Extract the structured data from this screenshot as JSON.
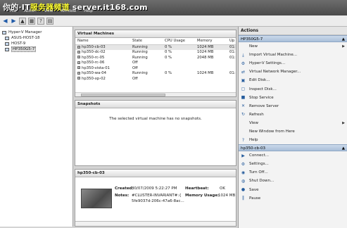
{
  "watermark": {
    "part1": "你的·IT",
    "part2": "服务器频道",
    "part3": " server.it168.com"
  },
  "menu": [
    "File",
    "Action",
    "View",
    "Window",
    "Help"
  ],
  "tree": {
    "root": "Hyper-V Manager",
    "hosts": [
      "ASUS-HOST-18",
      "HOST-9",
      "HP350G5-7"
    ],
    "selected_index": 2
  },
  "vms": {
    "title": "Virtual Machines",
    "columns": [
      "Name",
      "State",
      "CPU Usage",
      "Memory",
      "Up"
    ],
    "rows": [
      {
        "name": "hp350-cb-03",
        "state": "Running",
        "cpu": "0 %",
        "mem": "1024 MB",
        "up": "01:"
      },
      {
        "name": "hp350-dc-02",
        "state": "Running",
        "cpu": "0 %",
        "mem": "1024 MB",
        "up": "01:"
      },
      {
        "name": "hp350-rc-05",
        "state": "Running",
        "cpu": "0 %",
        "mem": "2048 MB",
        "up": "01:"
      },
      {
        "name": "hp350-rc-06",
        "state": "Off",
        "cpu": "",
        "mem": "",
        "up": ""
      },
      {
        "name": "hp350-vista-01",
        "state": "Off",
        "cpu": "",
        "mem": "",
        "up": ""
      },
      {
        "name": "hp350-wa-04",
        "state": "Running",
        "cpu": "0 %",
        "mem": "1024 MB",
        "up": "01:"
      },
      {
        "name": "hp350-xp-02",
        "state": "Off",
        "cpu": "",
        "mem": "",
        "up": ""
      }
    ]
  },
  "snapshots": {
    "title": "Snapshots",
    "message": "The selected virtual machine has no snapshots."
  },
  "details": {
    "title": "hp350-cb-03",
    "created_label": "Created:",
    "created_value": "30/07/2009 5:22:27 PM",
    "heartbeat_label": "Heartbeat:",
    "heartbeat_value": "OK",
    "notes_label": "Notes:",
    "notes_line1": "#CLUSTER-INVARIANT#:{",
    "notes_line2": "5fe9037d-206c-47a6-8ac...",
    "memusage_label": "Memory Usage:",
    "memusage_value": "1024 MB"
  },
  "actions": {
    "title": "Actions",
    "host_section": "HP350G5-7",
    "host_items": [
      {
        "icon": "blank",
        "label": "New",
        "submenu": true
      },
      {
        "icon": "import-icon",
        "label": "Import Virtual Machine..."
      },
      {
        "icon": "settings-icon",
        "label": "Hyper-V Settings..."
      },
      {
        "icon": "network-icon",
        "label": "Virtual Network Manager..."
      },
      {
        "icon": "disk-icon",
        "label": "Edit Disk..."
      },
      {
        "icon": "inspect-icon",
        "label": "Inspect Disk..."
      },
      {
        "icon": "stop-icon",
        "label": "Stop Service"
      },
      {
        "icon": "remove-icon",
        "label": "Remove Server"
      },
      {
        "icon": "refresh-icon",
        "label": "Refresh"
      },
      {
        "icon": "blank",
        "label": "View",
        "submenu": true
      },
      {
        "icon": "blank",
        "label": "New Window from Here"
      },
      {
        "icon": "help-icon",
        "label": "Help"
      }
    ],
    "vm_section": "hp350-cb-03",
    "vm_items": [
      {
        "icon": "connect-icon",
        "label": "Connect..."
      },
      {
        "icon": "settings-icon",
        "label": "Settings..."
      },
      {
        "icon": "power-icon",
        "label": "Turn Off..."
      },
      {
        "icon": "shutdown-icon",
        "label": "Shut Down..."
      },
      {
        "icon": "save-icon",
        "label": "Save"
      },
      {
        "icon": "pause-icon",
        "label": "Pause"
      }
    ]
  }
}
